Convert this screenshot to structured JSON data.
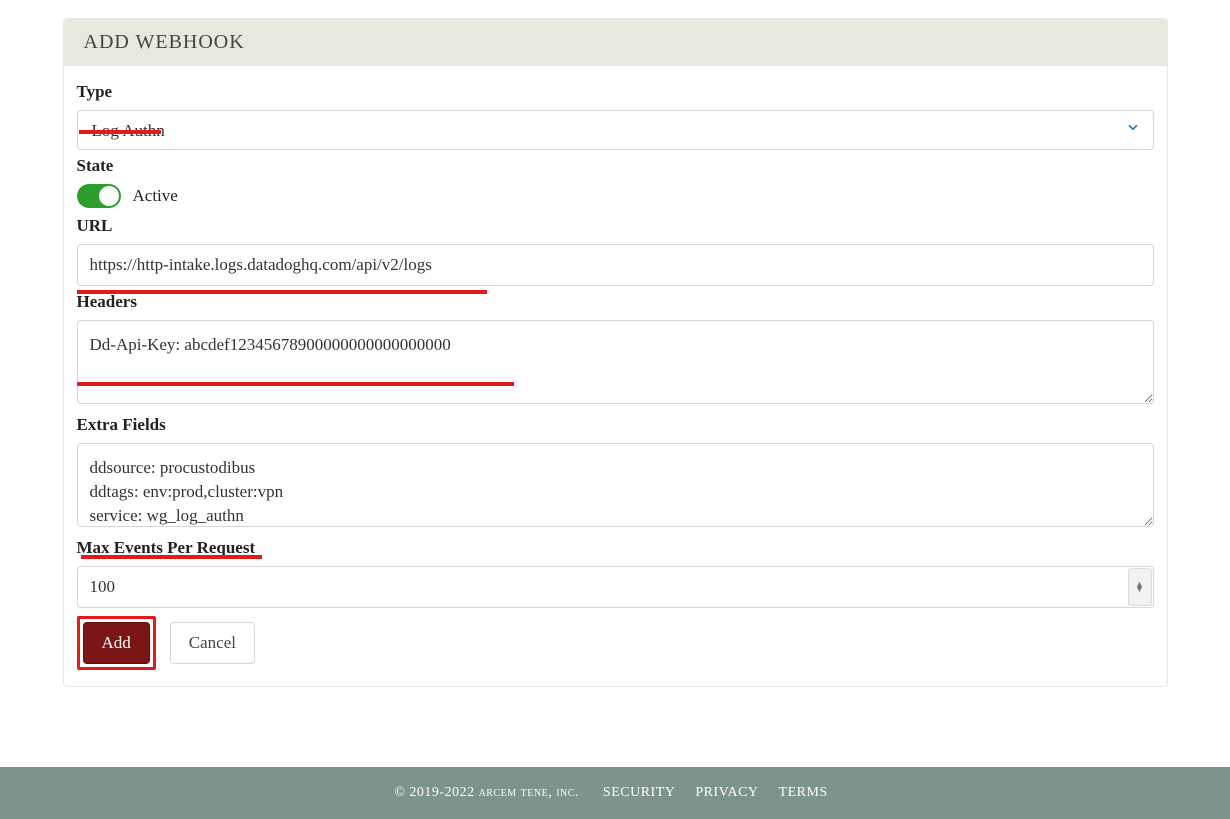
{
  "header": {
    "title": "ADD WEBHOOK"
  },
  "form": {
    "type_label": "Type",
    "type_value": "Log Authn",
    "state_label": "State",
    "state_text": "Active",
    "url_label": "URL",
    "url_value": "https://http-intake.logs.datadoghq.com/api/v2/logs",
    "headers_label": "Headers",
    "headers_value": "Dd-Api-Key: abcdef12345678900000000000000000",
    "extra_label": "Extra Fields",
    "extra_value": "ddsource: procustodibus\nddtags: env:prod,cluster:vpn\nservice: wg_log_authn",
    "max_label": "Max Events Per Request",
    "max_value": "100",
    "add_label": "Add",
    "cancel_label": "Cancel"
  },
  "footer": {
    "copyright": "© 2019-2022 arcem tene, inc.",
    "security": "SECURITY",
    "privacy": "PRIVACY",
    "terms": "TERMS"
  }
}
